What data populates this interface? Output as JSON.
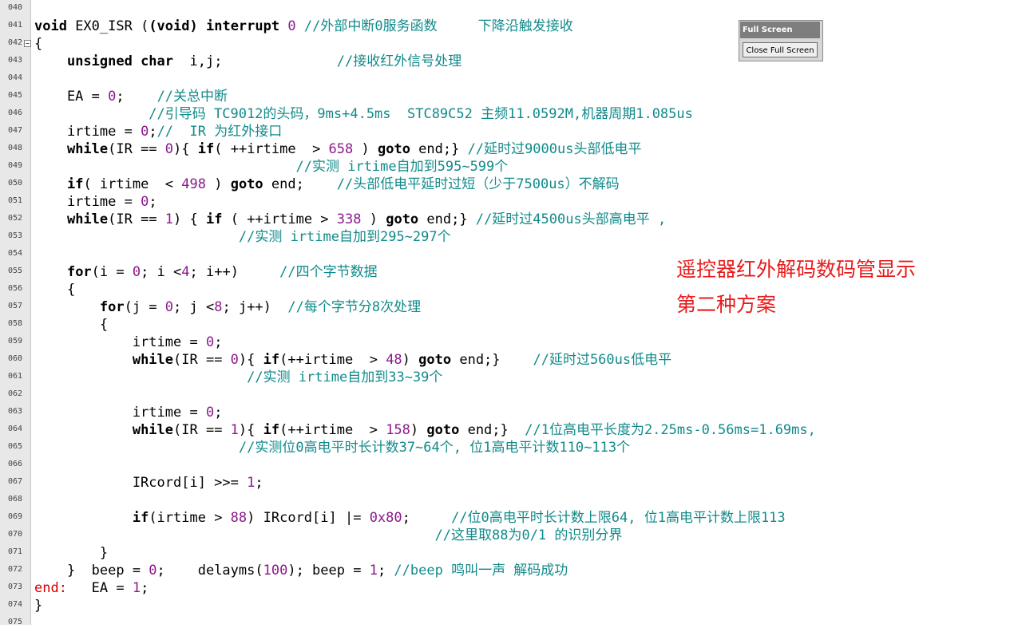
{
  "fullscreen_panel": {
    "title": "Full Screen",
    "close_label": "Close Full Screen"
  },
  "annotations": [
    "遥控器红外解码数码管显示",
    "第二种方案"
  ],
  "colors": {
    "keyword": "#000000",
    "number": "#8b1a8b",
    "comment": "#128a8a",
    "label": "#d40000",
    "annotation": "#e81c1c"
  },
  "lines": [
    {
      "n": "040",
      "t": []
    },
    {
      "n": "041",
      "t": [
        [
          "k",
          "void"
        ],
        [
          "p",
          " EX0_ISR ("
        ],
        [
          "k",
          "(void)"
        ],
        [
          "p",
          " "
        ],
        [
          "k",
          "interrupt"
        ],
        [
          "p",
          " "
        ],
        [
          "n",
          "0"
        ],
        [
          "p",
          " "
        ],
        [
          "c",
          "//外部中断0服务函数     下降沿触发接收"
        ]
      ]
    },
    {
      "n": "042",
      "fold": true,
      "t": [
        [
          "p",
          "{"
        ]
      ]
    },
    {
      "n": "043",
      "t": [
        [
          "p",
          "    "
        ],
        [
          "k",
          "unsigned char"
        ],
        [
          "p",
          "  i,j;              "
        ],
        [
          "c",
          "//接收红外信号处理"
        ]
      ]
    },
    {
      "n": "044",
      "t": []
    },
    {
      "n": "045",
      "t": [
        [
          "p",
          "    EA = "
        ],
        [
          "n",
          "0"
        ],
        [
          "p",
          ";    "
        ],
        [
          "c",
          "//关总中断"
        ]
      ]
    },
    {
      "n": "046",
      "t": [
        [
          "p",
          "              "
        ],
        [
          "c",
          "//引导码 TC9012的头码，9ms+4.5ms  STC89C52 主频11.0592M,机器周期1.085us"
        ]
      ]
    },
    {
      "n": "047",
      "t": [
        [
          "p",
          "    irtime = "
        ],
        [
          "n",
          "0"
        ],
        [
          "p",
          ";"
        ],
        [
          "c",
          "//  IR 为红外接口"
        ]
      ]
    },
    {
      "n": "048",
      "t": [
        [
          "p",
          "    "
        ],
        [
          "k",
          "while"
        ],
        [
          "p",
          "(IR == "
        ],
        [
          "n",
          "0"
        ],
        [
          "p",
          "){ "
        ],
        [
          "k",
          "if"
        ],
        [
          "p",
          "( ++irtime  > "
        ],
        [
          "n",
          "658"
        ],
        [
          "p",
          " ) "
        ],
        [
          "k",
          "goto"
        ],
        [
          "p",
          " end;} "
        ],
        [
          "c",
          "//延时过9000us头部低电平"
        ]
      ]
    },
    {
      "n": "049",
      "t": [
        [
          "p",
          "                                "
        ],
        [
          "c",
          "//实测 irtime自加到595~599个"
        ]
      ]
    },
    {
      "n": "050",
      "t": [
        [
          "p",
          "    "
        ],
        [
          "k",
          "if"
        ],
        [
          "p",
          "( irtime  < "
        ],
        [
          "n",
          "498"
        ],
        [
          "p",
          " ) "
        ],
        [
          "k",
          "goto"
        ],
        [
          "p",
          " end;    "
        ],
        [
          "c",
          "//头部低电平延时过短（少于7500us）不解码"
        ]
      ]
    },
    {
      "n": "051",
      "t": [
        [
          "p",
          "    irtime = "
        ],
        [
          "n",
          "0"
        ],
        [
          "p",
          ";"
        ]
      ]
    },
    {
      "n": "052",
      "t": [
        [
          "p",
          "    "
        ],
        [
          "k",
          "while"
        ],
        [
          "p",
          "(IR == "
        ],
        [
          "n",
          "1"
        ],
        [
          "p",
          ") { "
        ],
        [
          "k",
          "if"
        ],
        [
          "p",
          " ( ++irtime > "
        ],
        [
          "n",
          "338"
        ],
        [
          "p",
          " ) "
        ],
        [
          "k",
          "goto"
        ],
        [
          "p",
          " end;} "
        ],
        [
          "c",
          "//延时过4500us头部高电平 ,"
        ]
      ]
    },
    {
      "n": "053",
      "t": [
        [
          "p",
          "                         "
        ],
        [
          "c",
          "//实测 irtime自加到295~297个"
        ]
      ]
    },
    {
      "n": "054",
      "t": []
    },
    {
      "n": "055",
      "t": [
        [
          "p",
          "    "
        ],
        [
          "k",
          "for"
        ],
        [
          "p",
          "(i = "
        ],
        [
          "n",
          "0"
        ],
        [
          "p",
          "; i <"
        ],
        [
          "n",
          "4"
        ],
        [
          "p",
          "; i++)     "
        ],
        [
          "c",
          "//四个字节数据"
        ]
      ]
    },
    {
      "n": "056",
      "t": [
        [
          "p",
          "    {"
        ]
      ]
    },
    {
      "n": "057",
      "t": [
        [
          "p",
          "        "
        ],
        [
          "k",
          "for"
        ],
        [
          "p",
          "(j = "
        ],
        [
          "n",
          "0"
        ],
        [
          "p",
          "; j <"
        ],
        [
          "n",
          "8"
        ],
        [
          "p",
          "; j++)  "
        ],
        [
          "c",
          "//每个字节分8次处理"
        ]
      ]
    },
    {
      "n": "058",
      "t": [
        [
          "p",
          "        {"
        ]
      ]
    },
    {
      "n": "059",
      "t": [
        [
          "p",
          "            irtime = "
        ],
        [
          "n",
          "0"
        ],
        [
          "p",
          ";"
        ]
      ]
    },
    {
      "n": "060",
      "t": [
        [
          "p",
          "            "
        ],
        [
          "k",
          "while"
        ],
        [
          "p",
          "(IR == "
        ],
        [
          "n",
          "0"
        ],
        [
          "p",
          "){ "
        ],
        [
          "k",
          "if"
        ],
        [
          "p",
          "(++irtime  > "
        ],
        [
          "n",
          "48"
        ],
        [
          "p",
          ") "
        ],
        [
          "k",
          "goto"
        ],
        [
          "p",
          " end;}    "
        ],
        [
          "c",
          "//延时过560us低电平"
        ]
      ]
    },
    {
      "n": "061",
      "t": [
        [
          "p",
          "                          "
        ],
        [
          "c",
          "//实测 irtime自加到33~39个"
        ]
      ]
    },
    {
      "n": "062",
      "t": []
    },
    {
      "n": "063",
      "t": [
        [
          "p",
          "            irtime = "
        ],
        [
          "n",
          "0"
        ],
        [
          "p",
          ";"
        ]
      ]
    },
    {
      "n": "064",
      "t": [
        [
          "p",
          "            "
        ],
        [
          "k",
          "while"
        ],
        [
          "p",
          "(IR == "
        ],
        [
          "n",
          "1"
        ],
        [
          "p",
          "){ "
        ],
        [
          "k",
          "if"
        ],
        [
          "p",
          "(++irtime  > "
        ],
        [
          "n",
          "158"
        ],
        [
          "p",
          ") "
        ],
        [
          "k",
          "goto"
        ],
        [
          "p",
          " end;}  "
        ],
        [
          "c",
          "//1位高电平长度为2.25ms-0.56ms=1.69ms,"
        ]
      ]
    },
    {
      "n": "065",
      "t": [
        [
          "p",
          "                         "
        ],
        [
          "c",
          "//实测位0高电平时长计数37~64个, 位1高电平计数110~113个"
        ]
      ]
    },
    {
      "n": "066",
      "t": []
    },
    {
      "n": "067",
      "t": [
        [
          "p",
          "            IRcord[i] >>= "
        ],
        [
          "n",
          "1"
        ],
        [
          "p",
          ";"
        ]
      ]
    },
    {
      "n": "068",
      "t": []
    },
    {
      "n": "069",
      "t": [
        [
          "p",
          "            "
        ],
        [
          "k",
          "if"
        ],
        [
          "p",
          "(irtime > "
        ],
        [
          "n",
          "88"
        ],
        [
          "p",
          ") IRcord[i] |= "
        ],
        [
          "n",
          "0x80"
        ],
        [
          "p",
          ";     "
        ],
        [
          "c",
          "//位0高电平时长计数上限64, 位1高电平计数上限113"
        ]
      ]
    },
    {
      "n": "070",
      "t": [
        [
          "p",
          "                                                 "
        ],
        [
          "c",
          "//这里取88为0/1 的识别分界"
        ]
      ]
    },
    {
      "n": "071",
      "t": [
        [
          "p",
          "        }"
        ]
      ]
    },
    {
      "n": "072",
      "t": [
        [
          "p",
          "    }  beep = "
        ],
        [
          "n",
          "0"
        ],
        [
          "p",
          ";    delayms("
        ],
        [
          "n",
          "100"
        ],
        [
          "p",
          "); beep = "
        ],
        [
          "n",
          "1"
        ],
        [
          "p",
          "; "
        ],
        [
          "c",
          "//beep 鸣叫一声 解码成功"
        ]
      ]
    },
    {
      "n": "073",
      "t": [
        [
          "lb",
          "end:"
        ],
        [
          "p",
          "   EA = "
        ],
        [
          "n",
          "1"
        ],
        [
          "p",
          ";"
        ]
      ]
    },
    {
      "n": "074",
      "t": [
        [
          "p",
          "}"
        ]
      ]
    },
    {
      "n": "075",
      "t": []
    }
  ]
}
